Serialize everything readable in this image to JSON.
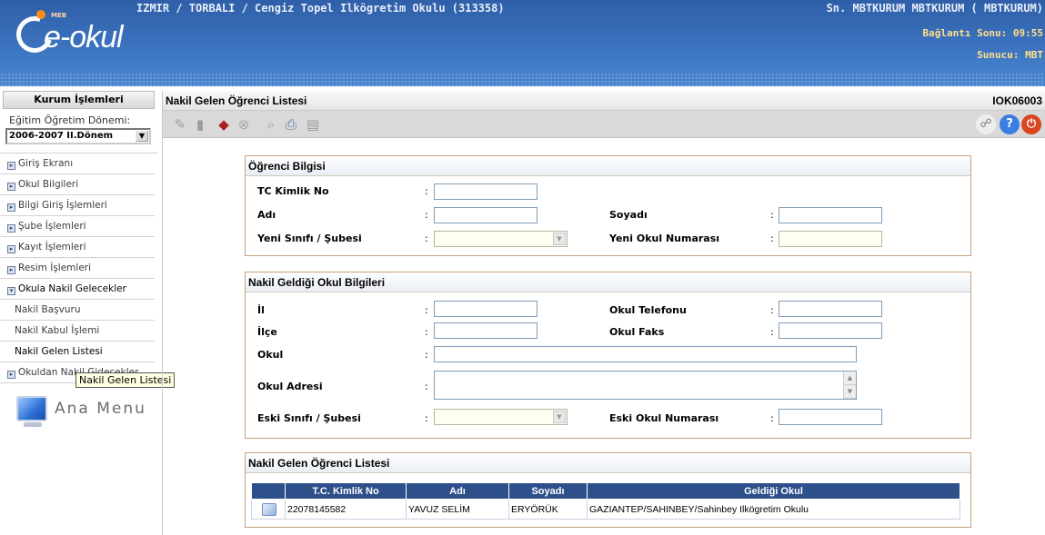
{
  "header": {
    "logo_text": "e-okul",
    "logo_small": "MEB",
    "school": "IZMIR / TORBALI / Cengiz Topel Ilkögretim Okulu (313358)",
    "user": "Sn. MBTKURUM MBTKURUM ( MBTKURUM)",
    "connection_end": "Bağlantı Sonu: 09:55",
    "server": "Sunucu: MBT"
  },
  "sidebar": {
    "header": "Kurum İşlemleri",
    "period_label": "Eğitim Öğretim Dönemi:",
    "period_value": "2006-2007 II.Dönem",
    "items": [
      {
        "label": "Giriş Ekranı",
        "type": "group"
      },
      {
        "label": "Okul Bilgileri",
        "type": "group"
      },
      {
        "label": "Bilgi Giriş İşlemleri",
        "type": "group"
      },
      {
        "label": "Şube İşlemleri",
        "type": "group"
      },
      {
        "label": "Kayıt İşlemleri",
        "type": "group"
      },
      {
        "label": "Resim İşlemleri",
        "type": "group"
      },
      {
        "label": "Okula Nakil Gelecekler",
        "type": "open"
      },
      {
        "label": "Nakil Başvuru",
        "type": "sub"
      },
      {
        "label": "Nakil Kabul İşlemi",
        "type": "sub"
      },
      {
        "label": "Nakil Gelen Listesi",
        "type": "sub-active"
      },
      {
        "label": "Okuldan Nakil Gidecekler",
        "type": "group"
      }
    ],
    "tooltip": "Nakil Gelen Listesi",
    "ana_menu": "Ana Menu"
  },
  "page": {
    "title": "Nakil Gelen Öğrenci Listesi",
    "code": "IOK06003"
  },
  "student_info": {
    "heading": "Öğrenci Bilgisi",
    "tc_label": "TC Kimlik No",
    "name_label": "Adı",
    "surname_label": "Soyadı",
    "class_label": "Yeni Sınıfı / Şubesi",
    "new_no_label": "Yeni Okul Numarası",
    "colon": ":"
  },
  "origin_info": {
    "heading": "Nakil Geldiği Okul Bilgileri",
    "il_label": "İl",
    "ilce_label": "İlçe",
    "okul_label": "Okul",
    "adres_label": "Okul Adresi",
    "old_class_label": "Eski Sınıfı / Şubesi",
    "phone_label": "Okul Telefonu",
    "fax_label": "Okul Faks",
    "old_no_label": "Eski Okul Numarası"
  },
  "list": {
    "heading": "Nakil Gelen Öğrenci Listesi",
    "columns": [
      "T.C. Kimlik No",
      "Adı",
      "Soyadı",
      "Geldiği Okul"
    ],
    "rows": [
      {
        "tc": "22078145582",
        "name": "YAVUZ SELİM",
        "surname": "ERYÖRÜK",
        "school": "GAZIANTEP/SAHINBEY/Sahinbey Ilkögretim Okulu"
      }
    ]
  }
}
